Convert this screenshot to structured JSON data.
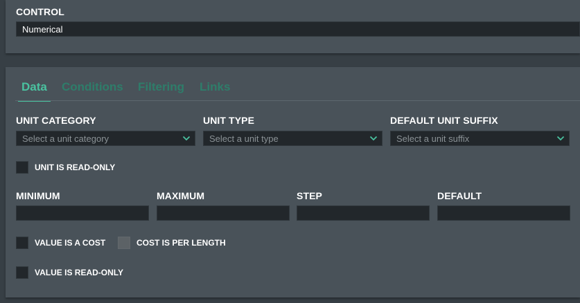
{
  "control": {
    "label": "CONTROL",
    "value": "Numerical"
  },
  "tabs": [
    {
      "label": "Data",
      "active": true
    },
    {
      "label": "Conditions",
      "active": false
    },
    {
      "label": "Filtering",
      "active": false
    },
    {
      "label": "Links",
      "active": false
    }
  ],
  "unit": {
    "category_label": "UNIT CATEGORY",
    "category_placeholder": "Select a unit category",
    "type_label": "UNIT TYPE",
    "type_placeholder": "Select a unit type",
    "suffix_label": "DEFAULT UNIT SUFFIX",
    "suffix_placeholder": "Select a unit suffix",
    "readonly_label": "UNIT IS READ-ONLY"
  },
  "numbers": {
    "minimum_label": "MINIMUM",
    "maximum_label": "MAXIMUM",
    "step_label": "STEP",
    "default_label": "DEFAULT",
    "minimum_value": "",
    "maximum_value": "",
    "step_value": "",
    "default_value": ""
  },
  "options": {
    "value_is_cost": "VALUE IS A COST",
    "cost_per_length": "COST IS PER LENGTH",
    "value_readonly": "VALUE IS READ-ONLY"
  },
  "colors": {
    "accent": "#4ac2a0",
    "tab_inactive": "#2e7d6a",
    "panel": "#495259",
    "background": "#373f45",
    "input": "#22272b"
  },
  "icons": {
    "dropdown": "chevron-down-icon"
  }
}
